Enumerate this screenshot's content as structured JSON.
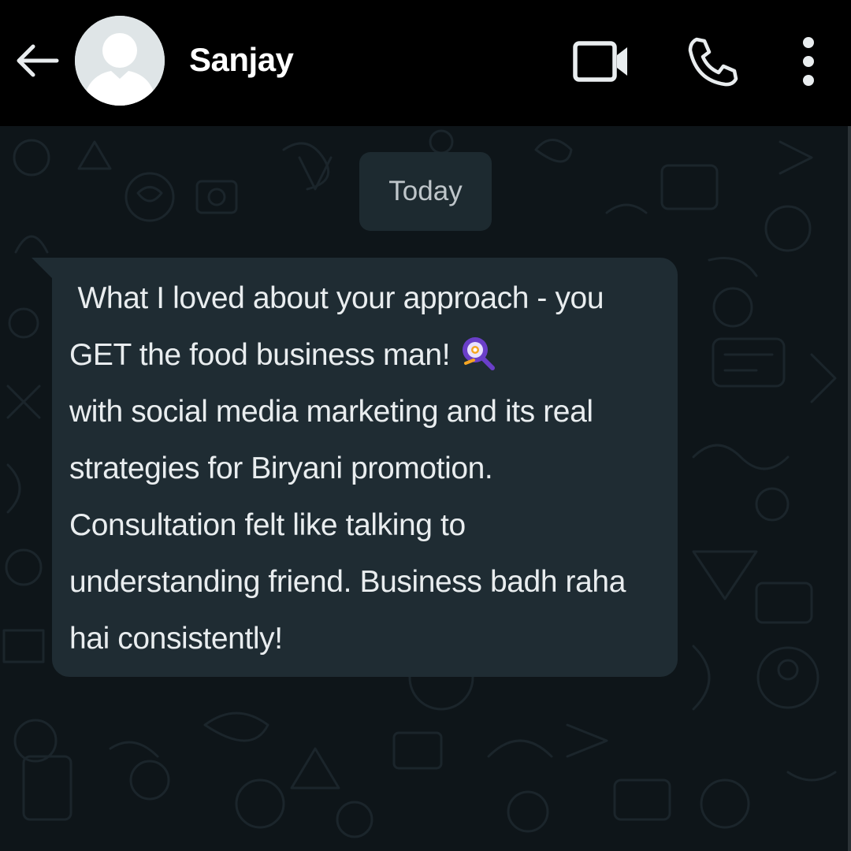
{
  "header": {
    "contact_name": "Sanjay",
    "icons": {
      "back": "arrow-left-icon",
      "avatar": "default-avatar-icon",
      "video": "video-camera-icon",
      "call": "phone-icon",
      "menu": "kebab-menu-icon"
    }
  },
  "chat": {
    "date_separator": "Today",
    "messages": [
      {
        "direction": "incoming",
        "text_before_emoji": " What I loved about your approach - you GET the food business man!",
        "emoji": "magnifying-glass-emoji",
        "text_after_emoji": "with social media marketing and its real strategies for Biryani promotion. Consultation felt like talking to understanding friend. Business badh raha hai consistently!"
      }
    ]
  },
  "colors": {
    "header_bg": "#000000",
    "chat_bg": "#0e1519",
    "bubble_bg": "#1f2c33",
    "text_primary": "#e9edef",
    "date_chip_bg": "#1d2a30",
    "date_chip_text": "#bfc6ca"
  }
}
